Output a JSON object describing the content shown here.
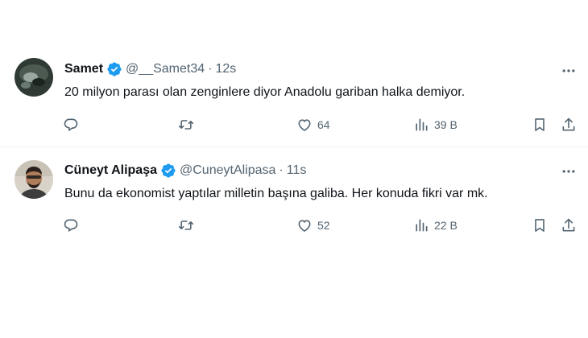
{
  "tweets": [
    {
      "name": "Samet",
      "handle": "@__Samet34",
      "separator": "·",
      "time": "12s",
      "text": "20 milyon parası olan zenginlere diyor Anadolu gariban halka demiyor.",
      "likes": "64",
      "views": "39 B",
      "avatar_icon": "dark-photo-avatar"
    },
    {
      "name": "Cüneyt Alipaşa",
      "handle": "@CuneytAlipasa",
      "separator": "·",
      "time": "11s",
      "text": "Bunu da ekonomist yaptılar milletin başına galiba. Her konuda fikri var mk.",
      "likes": "52",
      "views": "22 B",
      "avatar_icon": "portrait-photo-avatar"
    }
  ],
  "colors": {
    "text": "#0f1419",
    "secondary": "#536471",
    "verified": "#1d9bf0",
    "divider": "#eff3f4"
  },
  "icons": [
    "verified-badge-icon",
    "more-icon",
    "reply-icon",
    "retweet-icon",
    "like-icon",
    "views-icon",
    "bookmark-icon",
    "share-icon"
  ]
}
